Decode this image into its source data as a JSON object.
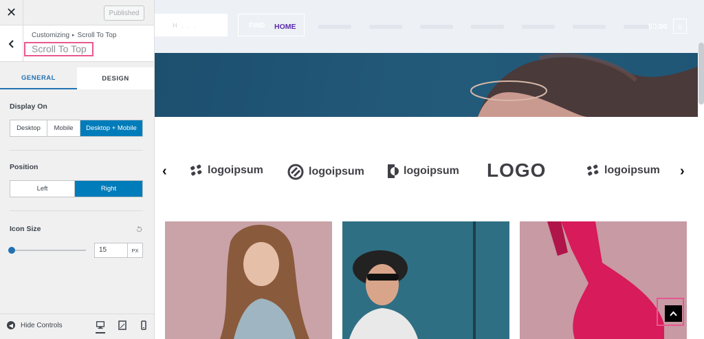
{
  "topbar": {
    "close_label": "✕",
    "published_label": "Published"
  },
  "header": {
    "back_label": "‹",
    "breadcrumb_parent": "Customizing",
    "breadcrumb_sep": "▸",
    "breadcrumb_current": "Scroll To Top",
    "title": "Scroll To Top"
  },
  "tabs": [
    {
      "label": "GENERAL",
      "active": true
    },
    {
      "label": "DESIGN",
      "active": false
    }
  ],
  "display_on": {
    "label": "Display On",
    "options": [
      "Desktop",
      "Mobile",
      "Desktop + Mobile"
    ],
    "selected": "Desktop + Mobile"
  },
  "position": {
    "label": "Position",
    "options": [
      "Left",
      "Right"
    ],
    "selected": "Right"
  },
  "icon_size": {
    "label": "Icon Size",
    "value": "15",
    "unit": "PX",
    "slider_fraction": 0.0
  },
  "footer": {
    "hide_controls_label": "Hide Controls"
  },
  "preview": {
    "nav_search_text": "H . . .",
    "find_label": "FIND",
    "home_label": "HOME",
    "cart_total": "$0.00",
    "cart_count": "0",
    "logos": [
      "logoipsum",
      "logoipsum",
      "logoipsum",
      "LOGO",
      "logoipsum"
    ],
    "prev_arrow": "‹",
    "next_arrow": "›"
  },
  "colors": {
    "accent": "#007cba",
    "highlight": "#e8578f",
    "nav_purple": "#5b2aa8"
  }
}
